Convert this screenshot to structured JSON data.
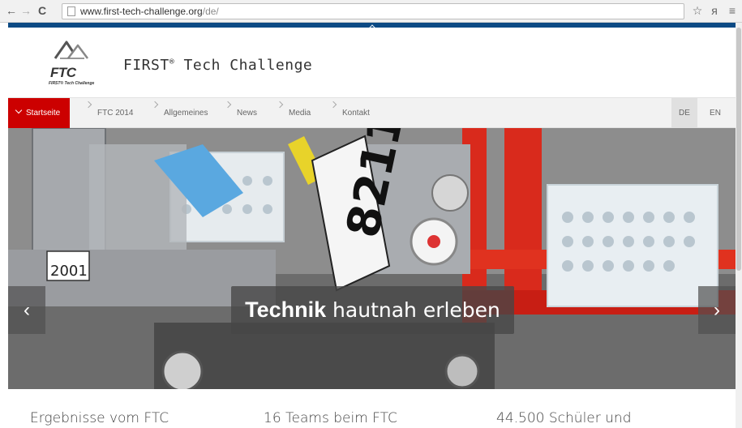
{
  "browser": {
    "url_host": "www.first-tech-challenge.org",
    "url_path": "/de/",
    "back_icon": "back-arrow-icon",
    "forward_icon": "forward-arrow-icon",
    "reload_icon": "reload-icon",
    "star_icon": "star-icon",
    "menu_icon": "hamburger-menu-icon"
  },
  "site": {
    "logo_text": "FTC",
    "logo_tagline": "FIRST® Tech Challenge",
    "title": "FIRST",
    "title_reg": "®",
    "title_rest": " Tech Challenge",
    "brand_blue": "#0c4a84",
    "accent_red": "#cc0000"
  },
  "menu": {
    "items": [
      {
        "label": "Startseite",
        "active": true
      },
      {
        "label": "FTC 2014",
        "active": false
      },
      {
        "label": "Allgemeines",
        "active": false
      },
      {
        "label": "News",
        "active": false
      },
      {
        "label": "Media",
        "active": false
      },
      {
        "label": "Kontakt",
        "active": false
      }
    ],
    "languages": [
      {
        "label": "DE",
        "active": true
      },
      {
        "label": "EN",
        "active": false
      }
    ]
  },
  "hero": {
    "caption_bold": "Technik",
    "caption_rest": " hautnah erleben",
    "prev_label": "‹",
    "next_label": "›",
    "robot_number": "8211",
    "sign_number": "2001"
  },
  "news": [
    {
      "title": "Ergebnisse vom FTC"
    },
    {
      "title": "16 Teams beim FTC"
    },
    {
      "title": "44.500 Schüler und"
    }
  ]
}
